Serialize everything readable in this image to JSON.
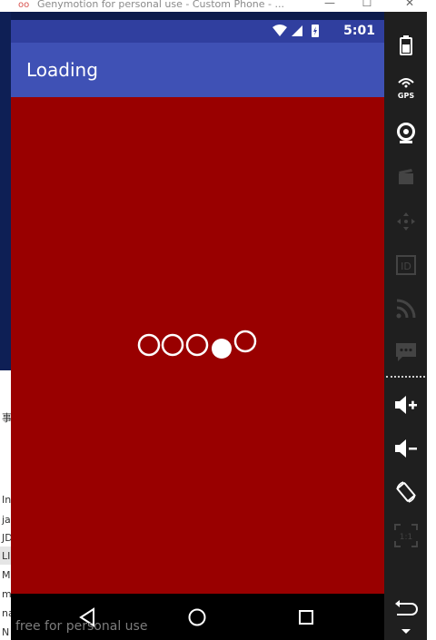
{
  "window": {
    "title": "Genymotion for personal use - Custom Phone - ...",
    "minimize_glyph": "—",
    "maximize_glyph": "☐",
    "close_glyph": "✕"
  },
  "desktop_list_fragments": [
    "事",
    "In",
    "ja",
    "JD",
    "LI",
    "M",
    "m",
    "na",
    "N"
  ],
  "status_bar": {
    "time": "5:01",
    "icons": [
      "wifi-icon",
      "signal-icon",
      "battery-charging-icon"
    ]
  },
  "app_bar": {
    "title": "Loading"
  },
  "content": {
    "background": "#990000",
    "loader": {
      "dots": [
        {
          "state": "outline"
        },
        {
          "state": "outline"
        },
        {
          "state": "outline"
        },
        {
          "state": "filled"
        },
        {
          "state": "outline"
        }
      ],
      "color": "#ffffff"
    }
  },
  "nav_bar": {
    "buttons": [
      "back-icon",
      "home-icon",
      "recents-icon"
    ]
  },
  "watermark": "free for personal use",
  "sidebar": {
    "gps_label": "GPS",
    "id_label": "ID",
    "pixel_perfect_label": "1:1",
    "buttons": [
      "battery-icon",
      "gps-icon",
      "camera-icon",
      "capture-icon",
      "remote-control-icon",
      "identifiers-icon",
      "network-icon",
      "sms-icon",
      "volume-up-icon",
      "volume-down-icon",
      "rotate-icon",
      "pixel-perfect-icon",
      "back-icon",
      "menu-icon"
    ]
  },
  "colors": {
    "status_bar": "#303f9f",
    "app_bar": "#3f51b5",
    "content": "#990000",
    "sidebar": "#1f1f1f"
  }
}
